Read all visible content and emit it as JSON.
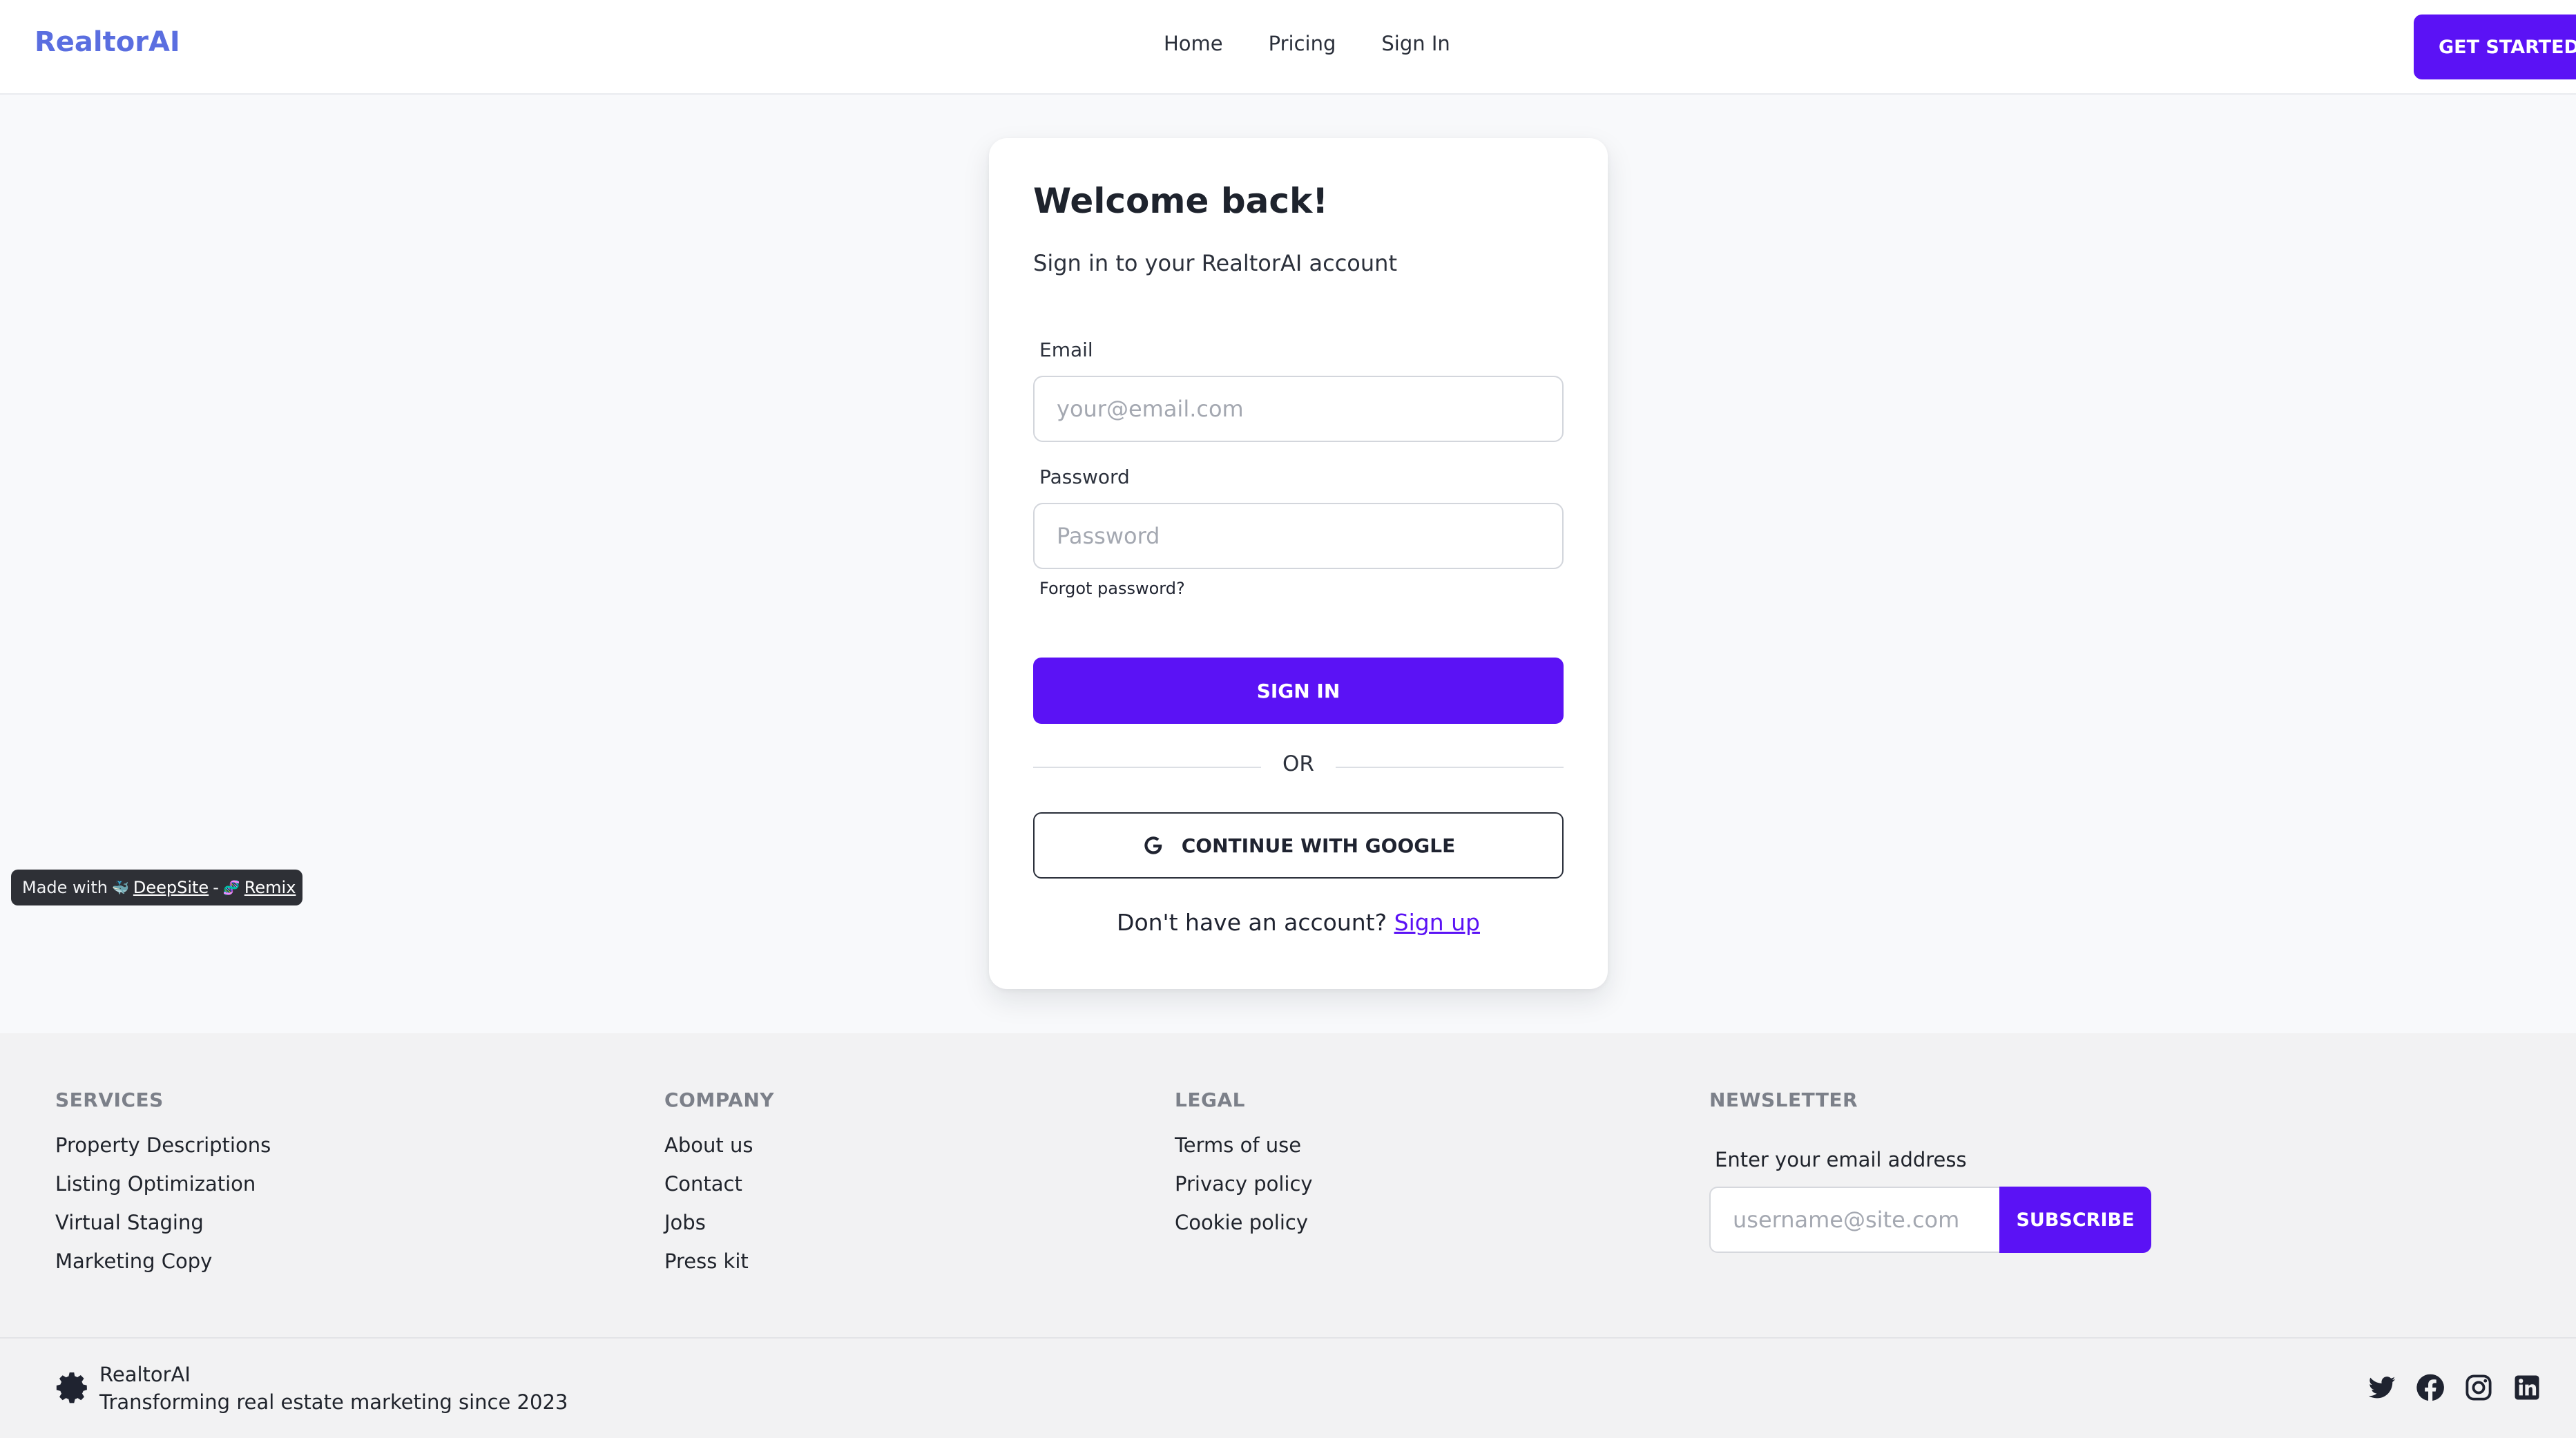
{
  "header": {
    "brand": "RealtorAI",
    "nav": [
      "Home",
      "Pricing",
      "Sign In"
    ],
    "cta": "GET STARTED"
  },
  "login": {
    "title": "Welcome back!",
    "subtitle": "Sign in to your RealtorAI account",
    "email_label": "Email",
    "email_placeholder": "your@email.com",
    "password_label": "Password",
    "password_placeholder": "Password",
    "forgot": "Forgot password?",
    "signin": "SIGN IN",
    "or": "OR",
    "google": "CONTINUE WITH GOOGLE",
    "no_account": "Don't have an account?",
    "signup": "Sign up"
  },
  "badge": {
    "made_with": "Made with",
    "deepsite": "DeepSite",
    "separator": "-",
    "remix": "Remix"
  },
  "footer": {
    "services": {
      "heading": "SERVICES",
      "links": [
        "Property Descriptions",
        "Listing Optimization",
        "Virtual Staging",
        "Marketing Copy"
      ]
    },
    "company": {
      "heading": "COMPANY",
      "links": [
        "About us",
        "Contact",
        "Jobs",
        "Press kit"
      ]
    },
    "legal": {
      "heading": "LEGAL",
      "links": [
        "Terms of use",
        "Privacy policy",
        "Cookie policy"
      ]
    },
    "newsletter": {
      "heading": "NEWSLETTER",
      "label": "Enter your email address",
      "placeholder": "username@site.com",
      "button": "SUBSCRIBE"
    },
    "brand_name": "RealtorAI",
    "tagline": "Transforming real estate marketing since 2023",
    "socials": [
      "twitter-icon",
      "facebook-icon",
      "instagram-icon",
      "linkedin-icon"
    ]
  },
  "colors": {
    "accent": "#5b12f5",
    "brand": "#5a6ee0",
    "background": "#f8f9fb",
    "footer": "#f2f2f3"
  }
}
